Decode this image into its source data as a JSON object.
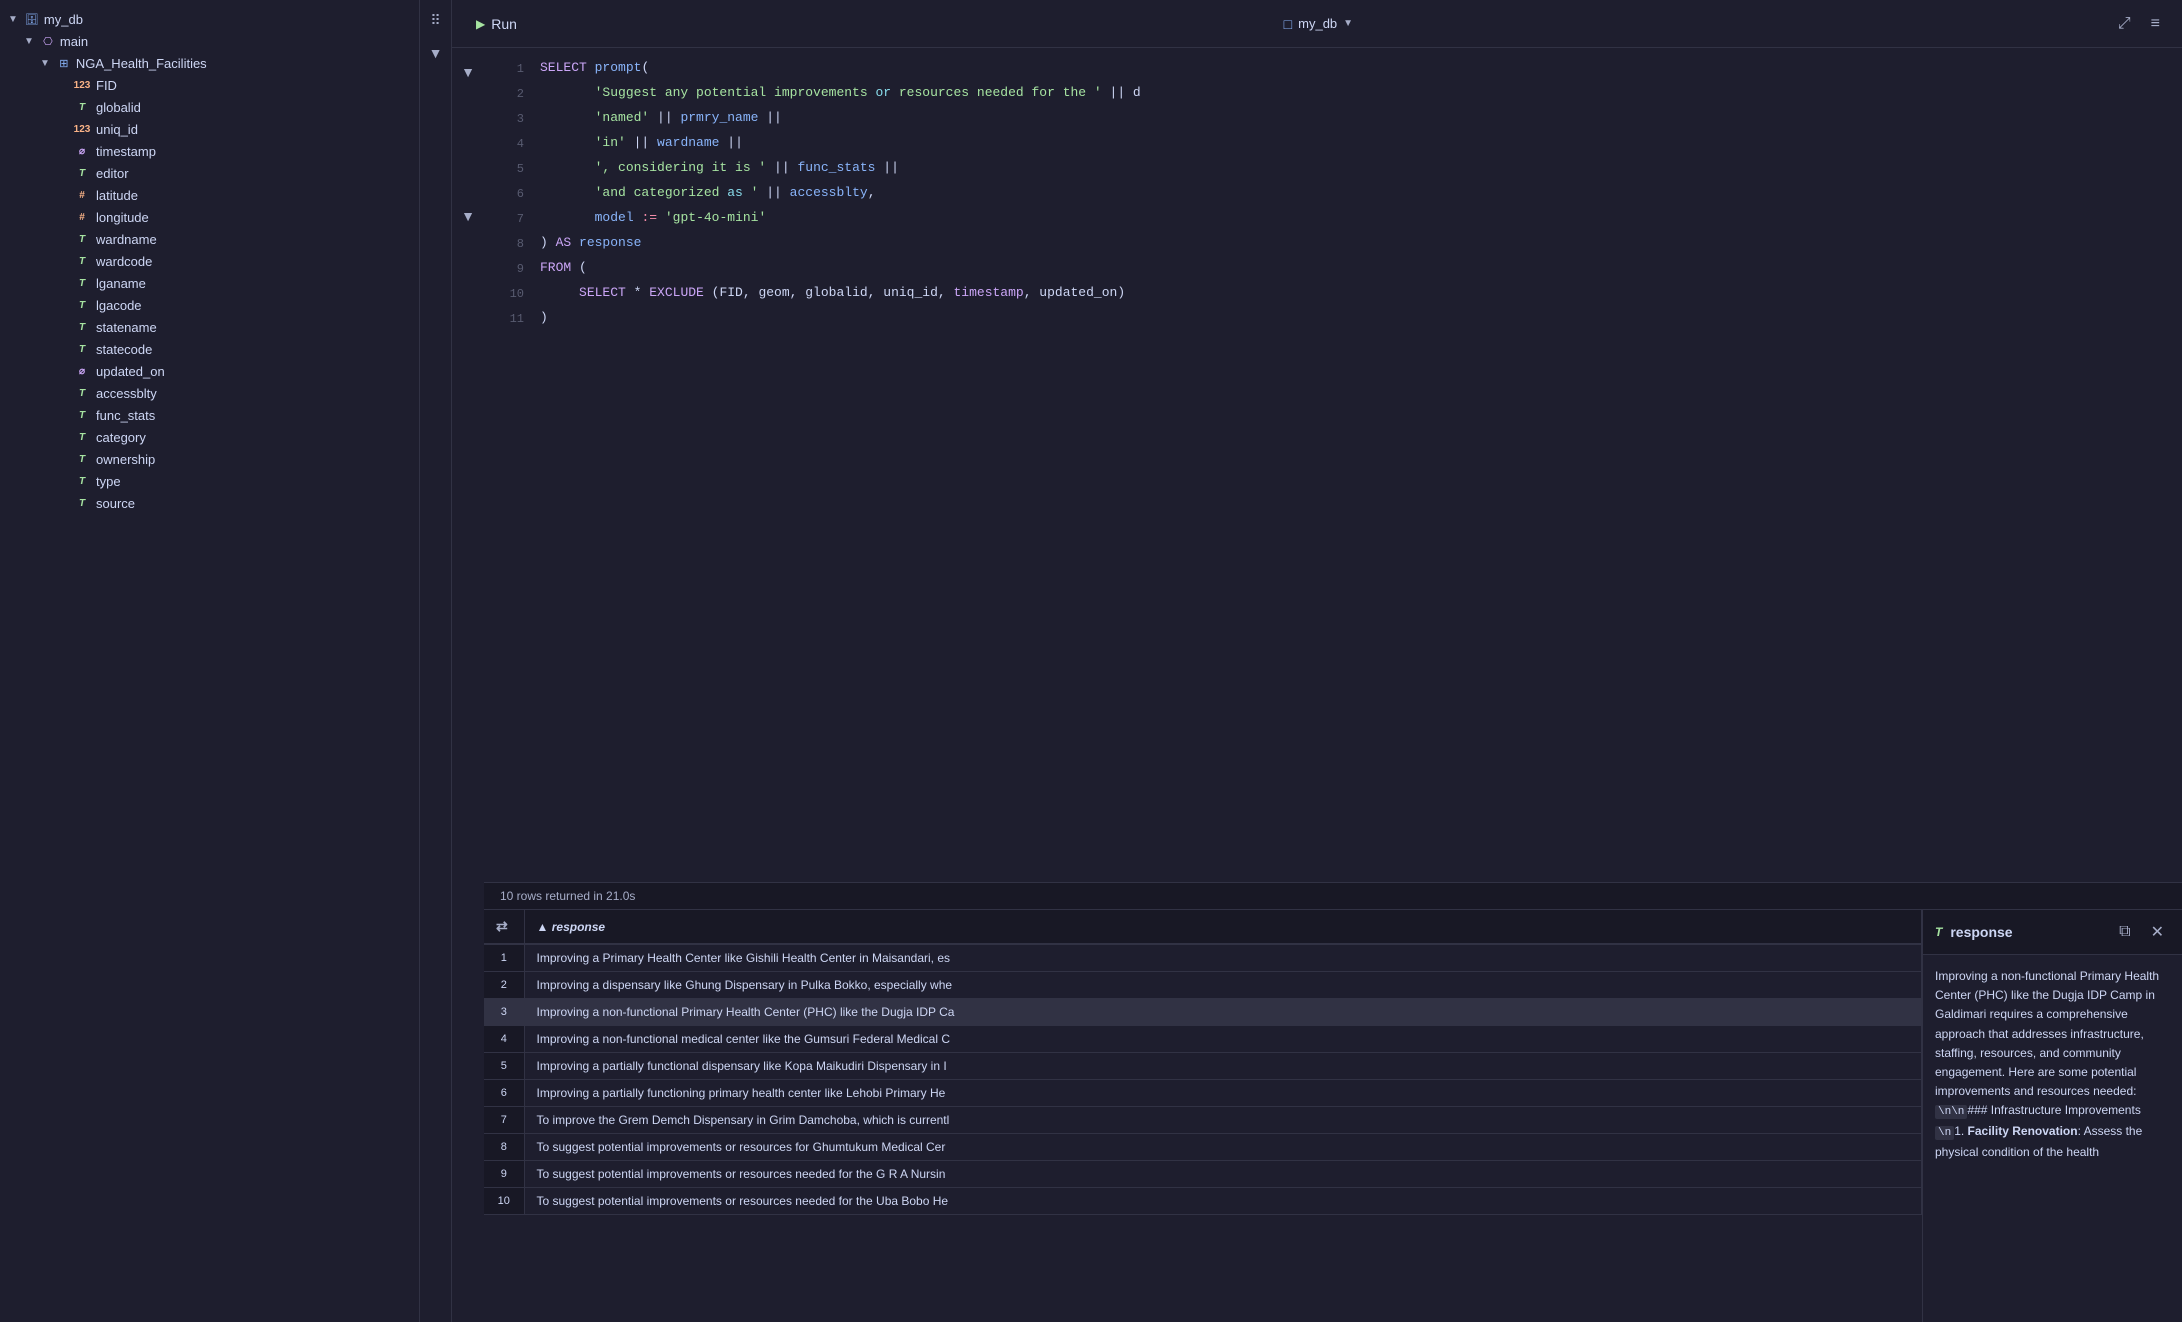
{
  "sidebar": {
    "db_name": "my_db",
    "schema_name": "main",
    "table_name": "NGA_Health_Facilities",
    "columns": [
      {
        "name": "FID",
        "type": "123",
        "type_label": "num"
      },
      {
        "name": "globalid",
        "type": "T",
        "type_label": "text"
      },
      {
        "name": "uniq_id",
        "type": "123",
        "type_label": "num"
      },
      {
        "name": "timestamp",
        "type": "ts",
        "type_label": "ts"
      },
      {
        "name": "editor",
        "type": "T",
        "type_label": "text"
      },
      {
        "name": "latitude",
        "type": "#",
        "type_label": "hash"
      },
      {
        "name": "longitude",
        "type": "#",
        "type_label": "hash"
      },
      {
        "name": "wardname",
        "type": "T",
        "type_label": "text"
      },
      {
        "name": "wardcode",
        "type": "T",
        "type_label": "text"
      },
      {
        "name": "lganame",
        "type": "T",
        "type_label": "text"
      },
      {
        "name": "lgacode",
        "type": "T",
        "type_label": "text"
      },
      {
        "name": "statename",
        "type": "T",
        "type_label": "text"
      },
      {
        "name": "statecode",
        "type": "T",
        "type_label": "text"
      },
      {
        "name": "updated_on",
        "type": "ts",
        "type_label": "ts"
      },
      {
        "name": "accessblty",
        "type": "T",
        "type_label": "text"
      },
      {
        "name": "func_stats",
        "type": "T",
        "type_label": "text"
      },
      {
        "name": "category",
        "type": "T",
        "type_label": "text"
      },
      {
        "name": "ownership",
        "type": "T",
        "type_label": "text"
      },
      {
        "name": "type",
        "type": "T",
        "type_label": "text"
      },
      {
        "name": "source",
        "type": "T",
        "type_label": "text"
      }
    ]
  },
  "toolbar": {
    "run_label": "Run",
    "db_label": "my_db",
    "expand_icon": "⤢",
    "menu_icon": "≡"
  },
  "editor": {
    "lines": [
      {
        "num": 1,
        "text": "SELECT prompt("
      },
      {
        "num": 2,
        "text": "    'Suggest any potential improvements or resources needed for the ' || d"
      },
      {
        "num": 3,
        "text": "    'named' || prmry_name ||"
      },
      {
        "num": 4,
        "text": "    'in' || wardname ||"
      },
      {
        "num": 5,
        "text": "    ', considering it is ' || func_stats ||"
      },
      {
        "num": 6,
        "text": "    'and categorized as ' || accessblty,"
      },
      {
        "num": 7,
        "text": "    model := 'gpt-4o-mini'"
      },
      {
        "num": 8,
        "text": ") AS response"
      },
      {
        "num": 9,
        "text": "FROM ("
      },
      {
        "num": 10,
        "text": "    SELECT * EXCLUDE (FID, geom, globalid, uniq_id, timestamp, updated_on)"
      },
      {
        "num": 11,
        "text": ")"
      }
    ]
  },
  "results": {
    "status": "10 rows returned in 21.0s",
    "column_header": "response",
    "sort_direction": "▲",
    "rows": [
      {
        "id": 1,
        "text": "Improving a Primary Health Center like Gishili Health Center in Maisandari, es"
      },
      {
        "id": 2,
        "text": "Improving a dispensary like Ghung Dispensary in Pulka Bokko, especially whe"
      },
      {
        "id": 3,
        "text": "Improving a non-functional Primary Health Center (PHC) like the Dugja IDP Ca",
        "selected": true
      },
      {
        "id": 4,
        "text": "Improving a non-functional medical center like the Gumsuri Federal Medical C"
      },
      {
        "id": 5,
        "text": "Improving a partially functional dispensary like Kopa Maikudiri Dispensary in I"
      },
      {
        "id": 6,
        "text": "Improving a partially functioning primary health center like Lehobi Primary He"
      },
      {
        "id": 7,
        "text": "To improve the Grem Demch Dispensary in Grim Damchoba, which is currentl"
      },
      {
        "id": 8,
        "text": "To suggest potential improvements or resources for Ghumtukum Medical Cer"
      },
      {
        "id": 9,
        "text": "To suggest potential improvements or resources needed for the G R A Nursin"
      },
      {
        "id": 10,
        "text": "To suggest potential improvements or resources needed for the Uba Bobo He"
      }
    ]
  },
  "side_panel": {
    "type_icon": "T",
    "title": "response",
    "copy_icon": "⧉",
    "close_icon": "✕",
    "content": "Improving a non-functional Primary Health Center (PHC) like the Dugja IDP Camp in Galdimari requires a comprehensive approach that addresses infrastructure, staffing, resources, and community engagement. Here are some potential improvements and resources needed: \\n\\n### Infrastructure Improvements\\n1. **Facility Renovation**: Assess the physical condition of the health"
  }
}
